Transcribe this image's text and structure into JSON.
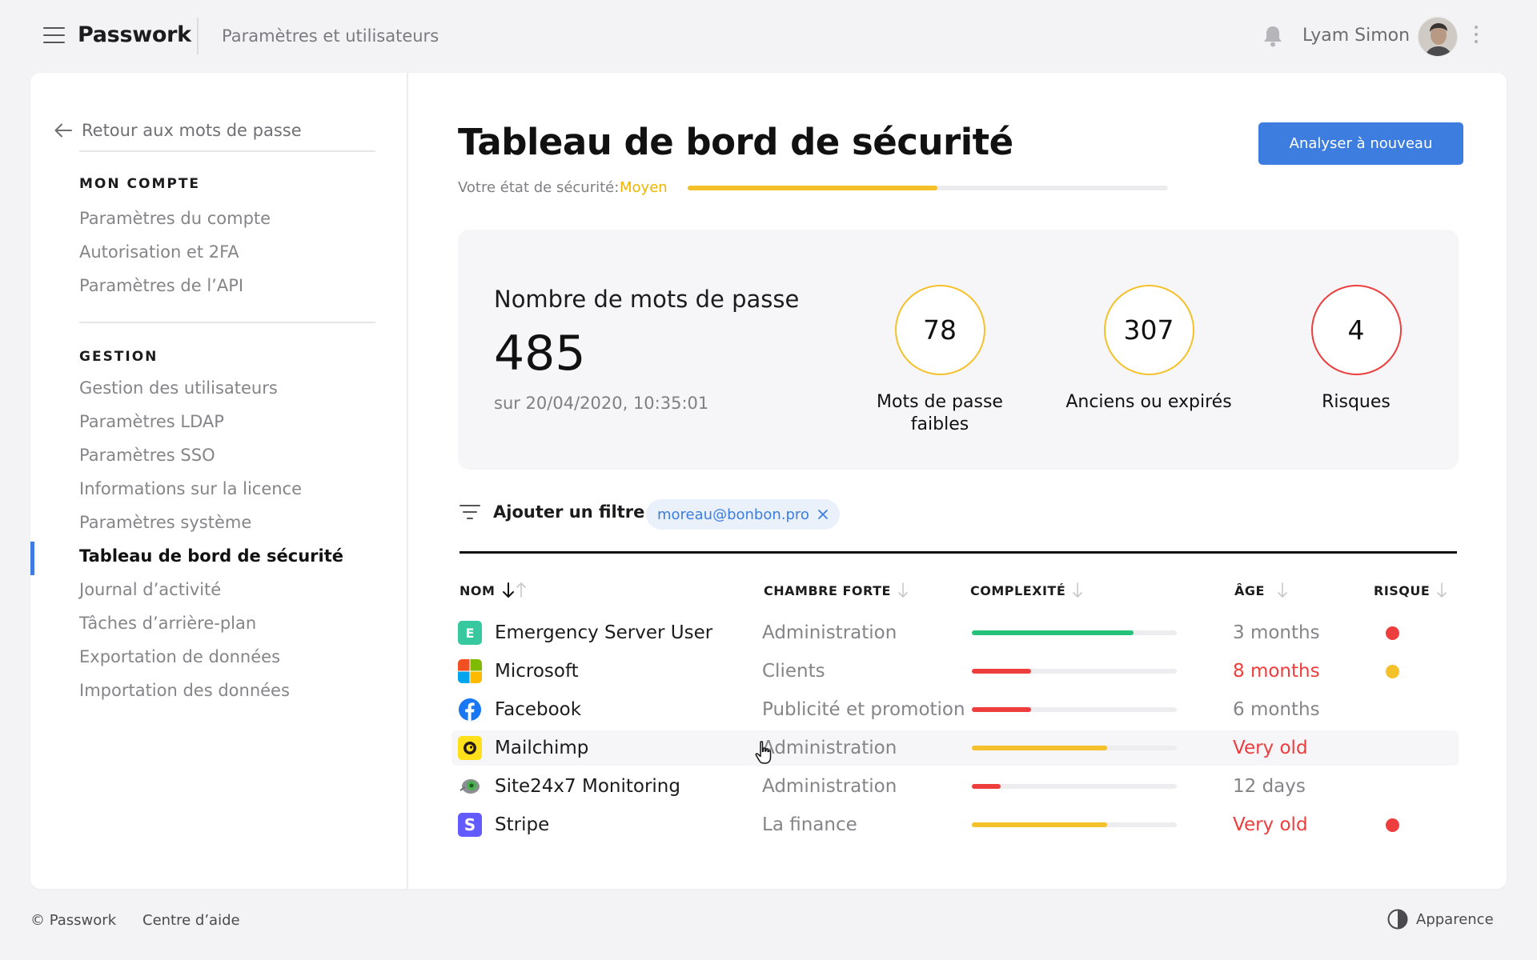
{
  "app": {
    "brand": "Passwork",
    "section_title": "Paramètres et utilisateurs"
  },
  "user": {
    "name": "Lyam Simon"
  },
  "sidebar": {
    "back_label": "Retour aux mots de passe",
    "heading_account": "MON COMPTE",
    "account_items": [
      "Paramètres du compte",
      "Autorisation et 2FA",
      "Paramètres de l’API"
    ],
    "heading_management": "GESTION",
    "management_items": [
      "Gestion des utilisateurs",
      "Paramètres LDAP",
      "Paramètres SSO",
      "Informations sur la licence",
      "Paramètres système",
      "Tableau de bord de sécurité",
      "Journal d’activité",
      "Tâches d’arrière-plan",
      "Exportation de données",
      "Importation des données"
    ],
    "active_item": "Tableau de bord de sécurité"
  },
  "dashboard": {
    "title": "Tableau de bord de sécurité",
    "rescan_button": "Analyser à nouveau",
    "security_state_label": "Votre état de sécurité:",
    "security_state_value": "Moyen",
    "security_level": 0.52,
    "password_count_label": "Nombre de mots de passe",
    "password_count": "485",
    "scan_date": "sur 20/04/2020, 10:35:01",
    "stats": [
      {
        "value": "78",
        "label": "Mots de passe faibles",
        "color": "#f5c12a"
      },
      {
        "value": "307",
        "label": "Anciens ou expirés",
        "color": "#f5c12a"
      },
      {
        "value": "4",
        "label": "Risques",
        "color": "#ee3d3d"
      }
    ]
  },
  "filter": {
    "add_filter_label": "Ajouter un filtre",
    "active_chip": "moreau@bonbon.pro"
  },
  "table": {
    "columns": {
      "name": "NOM",
      "vault": "CHAMBRE FORTE",
      "complexity": "COMPLEXITÉ",
      "age": "ÂGE",
      "risk": "RISQUE"
    },
    "rows": [
      {
        "name": "Emergency Server User",
        "icon": "letter-e-icon",
        "vault": "Administration",
        "complexity": 0.79,
        "complexity_color": "#27c27a",
        "age": "3 months",
        "age_alert": false,
        "risk": "#ee3d3d"
      },
      {
        "name": "Microsoft",
        "icon": "microsoft-logo-icon",
        "vault": "Clients",
        "complexity": 0.29,
        "complexity_color": "#ee3d3d",
        "age": "8 months",
        "age_alert": true,
        "risk": "#f5c12a"
      },
      {
        "name": "Facebook",
        "icon": "facebook-logo-icon",
        "vault": "Publicité et promotion",
        "complexity": 0.29,
        "complexity_color": "#ee3d3d",
        "age": "6 months",
        "age_alert": false,
        "risk": null
      },
      {
        "name": "Mailchimp",
        "icon": "mailchimp-logo-icon",
        "vault": "Administration",
        "complexity": 0.66,
        "complexity_color": "#f5c12a",
        "age": "Very old",
        "age_alert": true,
        "risk": null
      },
      {
        "name": "Site24x7 Monitoring",
        "icon": "site24x7-logo-icon",
        "vault": "Administration",
        "complexity": 0.14,
        "complexity_color": "#ee3d3d",
        "age": "12 days",
        "age_alert": false,
        "risk": null
      },
      {
        "name": "Stripe",
        "icon": "stripe-logo-icon",
        "vault": "La finance",
        "complexity": 0.66,
        "complexity_color": "#f5c12a",
        "age": "Very old",
        "age_alert": true,
        "risk": "#ee3d3d"
      }
    ]
  },
  "footer": {
    "copyright": "© Passwork",
    "help": "Centre d’aide",
    "appearance": "Apparence"
  },
  "colors": {
    "accent": "#3d7ddf",
    "warning": "#f5c12a",
    "danger": "#ee3d3d",
    "success": "#27c27a"
  }
}
